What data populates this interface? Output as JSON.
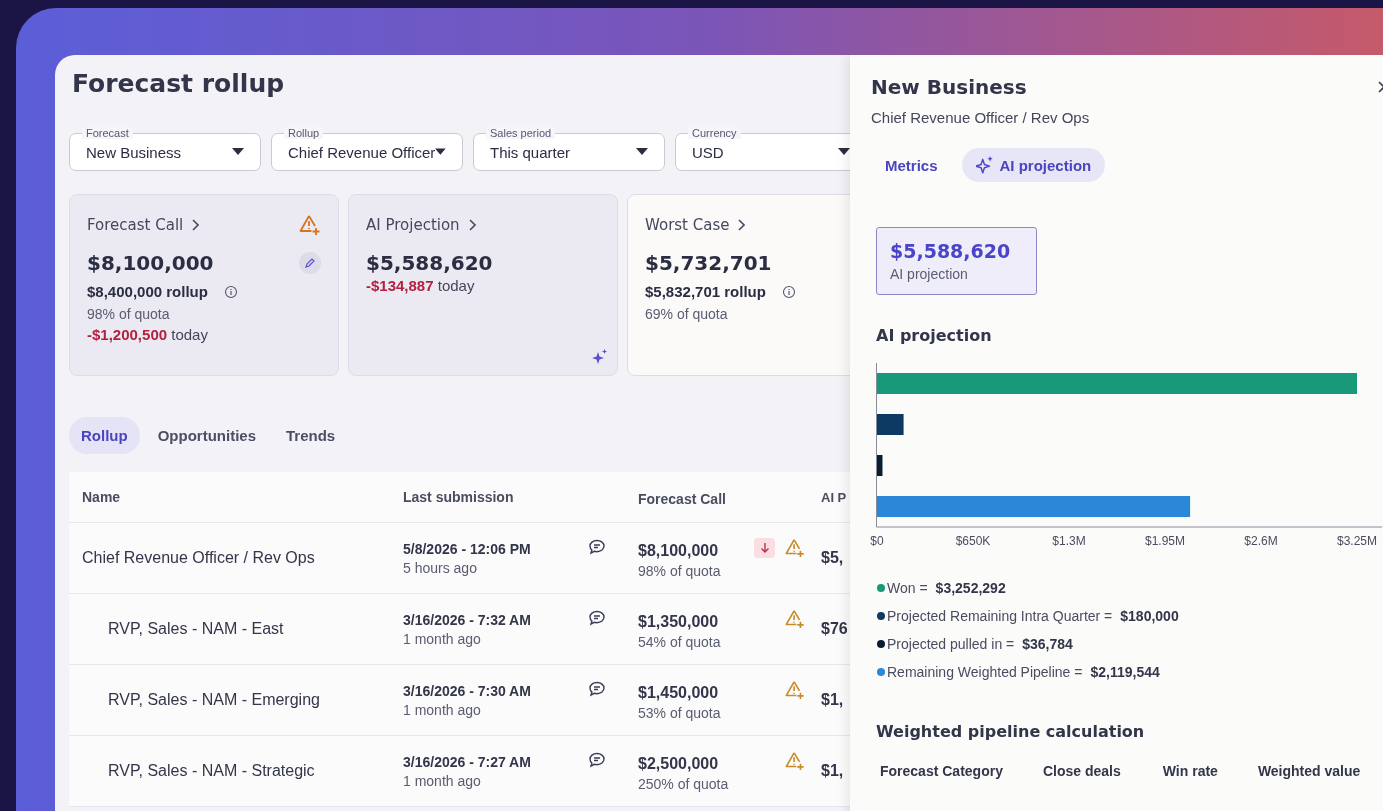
{
  "page": {
    "title": "Forecast rollup"
  },
  "filters": [
    {
      "label": "Forecast",
      "value": "New Business"
    },
    {
      "label": "Rollup",
      "value": "Chief Revenue Officer"
    },
    {
      "label": "Sales period",
      "value": "This quarter"
    },
    {
      "label": "Currency",
      "value": "USD"
    }
  ],
  "cards": [
    {
      "title": "Forecast Call",
      "alert": true,
      "editable": true,
      "ai_generated": false,
      "amount": "$8,100,000",
      "rollup": "$8,400,000 rollup",
      "quota": "98% of quota",
      "change": "-$1,200,500",
      "change_note": "today"
    },
    {
      "title": "AI Projection",
      "alert": false,
      "editable": false,
      "ai_generated": true,
      "amount": "$5,588,620",
      "change": "-$134,887",
      "change_note": "today"
    },
    {
      "title": "Worst Case",
      "alert": false,
      "editable": false,
      "ai_generated": false,
      "amount": "$5,732,701",
      "rollup": "$5,832,701 rollup",
      "quota": "69% of quota"
    }
  ],
  "tabs": [
    {
      "label": "Rollup",
      "selected": true
    },
    {
      "label": "Opportunities",
      "selected": false
    },
    {
      "label": "Trends",
      "selected": false
    }
  ],
  "table": {
    "columns": [
      "Name",
      "Last submission",
      "Forecast Call",
      "AI P"
    ],
    "rows": [
      {
        "name": "Chief Revenue Officer / Rev Ops",
        "submitted": "5/8/2026 - 12:06 PM",
        "ago": "5 hours ago",
        "forecast": "$8,100,000",
        "quota": "98% of quota",
        "trend_down": true,
        "alert": true,
        "column_4": "$5,",
        "children": [
          {
            "name": "RVP, Sales - NAM - East",
            "submitted": "3/16/2026 - 7:32 AM",
            "ago": "1 month ago",
            "forecast": "$1,350,000",
            "quota": "54% of quota",
            "trend_down": false,
            "alert": true,
            "column_4": "$76"
          },
          {
            "name": "RVP, Sales - NAM - Emerging",
            "submitted": "3/16/2026 - 7:30 AM",
            "ago": "1 month ago",
            "forecast": "$1,450,000",
            "quota": "53% of quota",
            "trend_down": false,
            "alert": true,
            "column_4": "$1,"
          },
          {
            "name": "RVP, Sales - NAM - Strategic",
            "submitted": "3/16/2026 - 7:27 AM",
            "ago": "1 month ago",
            "forecast": "$2,500,000",
            "quota": "250% of quota",
            "trend_down": false,
            "alert": true,
            "column_4": "$1,"
          }
        ]
      }
    ]
  },
  "drawer": {
    "title": "New Business",
    "subtitle": "Chief Revenue Officer / Rev Ops",
    "tabs": [
      {
        "label": "Metrics",
        "kind": "plain",
        "selected": false
      },
      {
        "label": "AI projection",
        "kind": "ai",
        "selected": true
      }
    ],
    "summary": {
      "value": "$5,588,620",
      "label": "AI projection"
    },
    "section_title": "AI projection",
    "chart_data": {
      "type": "bar",
      "orientation": "horizontal",
      "categories": [
        null,
        null,
        null,
        null
      ],
      "values": [
        3250000,
        180000,
        37000,
        2120000
      ],
      "colors": [
        "#17997a",
        "#0d3a63",
        "#0a1c30",
        "#2b88d8"
      ],
      "xlim": [
        0,
        3420000
      ],
      "xticks": [
        {
          "value": 0,
          "label": "$0"
        },
        {
          "value": 650000,
          "label": "$650K"
        },
        {
          "value": 1300000,
          "label": "$1.3M"
        },
        {
          "value": 1950000,
          "label": "$1.95M"
        },
        {
          "value": 2600000,
          "label": "$2.6M"
        },
        {
          "value": 3250000,
          "label": "$3.25M"
        }
      ]
    },
    "legend": [
      {
        "label": "Won =",
        "value": "$3,252,292",
        "color": "#17997a"
      },
      {
        "label": "Projected Remaining Intra Quarter =",
        "value": "$180,000",
        "color": "#0d3a63"
      },
      {
        "label": "Projected pulled in =",
        "value": "$36,784",
        "color": "#0a1c30"
      },
      {
        "label": "Remaining Weighted Pipeline =",
        "value": "$2,119,544",
        "color": "#2b88d8"
      }
    ],
    "calc_title": "Weighted pipeline calculation",
    "calc_columns": [
      "Forecast Category",
      "Close deals",
      "Win rate",
      "Weighted value"
    ]
  }
}
